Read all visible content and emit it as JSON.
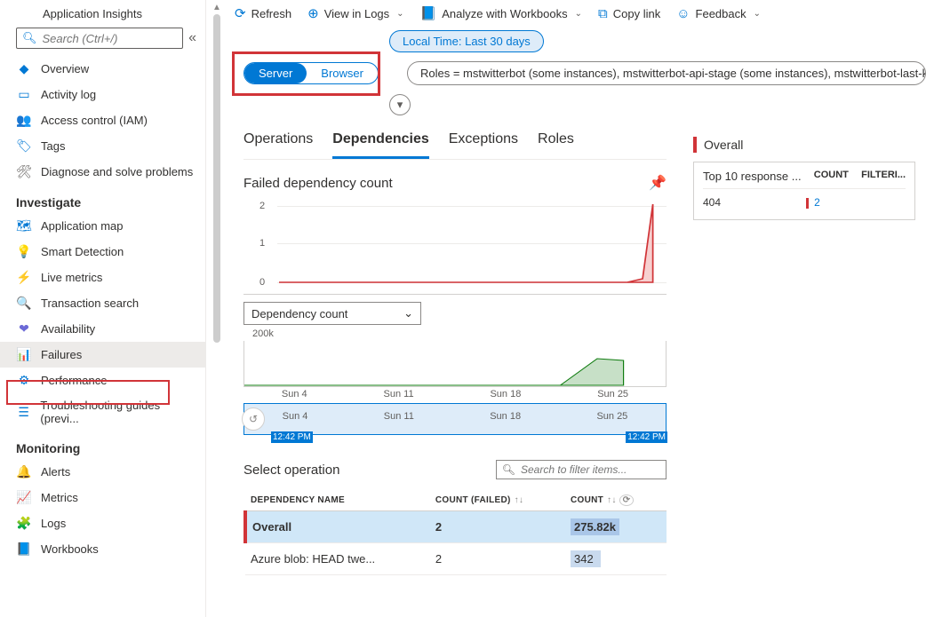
{
  "header": {
    "title": "Application Insights",
    "search_placeholder": "Search (Ctrl+/)"
  },
  "nav": {
    "items_top": [
      {
        "icon": "◆",
        "color": "#0078d4",
        "label": "Overview",
        "name": "overview"
      },
      {
        "icon": "▭",
        "color": "#0078d4",
        "label": "Activity log",
        "name": "activity-log"
      },
      {
        "icon": "👥",
        "color": "#0078d4",
        "label": "Access control (IAM)",
        "name": "access-control"
      },
      {
        "icon": "🏷",
        "color": "#0078d4",
        "label": "Tags",
        "name": "tags"
      },
      {
        "icon": "🛠",
        "color": "#605e5c",
        "label": "Diagnose and solve problems",
        "name": "diagnose"
      }
    ],
    "group_investigate": "Investigate",
    "items_investigate": [
      {
        "icon": "🗺",
        "color": "#0078d4",
        "label": "Application map",
        "name": "application-map"
      },
      {
        "icon": "💡",
        "color": "#d29200",
        "label": "Smart Detection",
        "name": "smart-detection"
      },
      {
        "icon": "⚡",
        "color": "#0078d4",
        "label": "Live metrics",
        "name": "live-metrics"
      },
      {
        "icon": "🔍",
        "color": "#0078d4",
        "label": "Transaction search",
        "name": "transaction-search"
      },
      {
        "icon": "❤",
        "color": "#6b69d6",
        "label": "Availability",
        "name": "availability"
      },
      {
        "icon": "📊",
        "color": "#d13438",
        "label": "Failures",
        "name": "failures",
        "active": true
      },
      {
        "icon": "⚙",
        "color": "#0078d4",
        "label": "Performance",
        "name": "performance"
      },
      {
        "icon": "☰",
        "color": "#0078d4",
        "label": "Troubleshooting guides (previ...",
        "name": "troubleshooting"
      }
    ],
    "group_monitoring": "Monitoring",
    "items_monitoring": [
      {
        "icon": "🔔",
        "color": "#107c10",
        "label": "Alerts",
        "name": "alerts"
      },
      {
        "icon": "📈",
        "color": "#0078d4",
        "label": "Metrics",
        "name": "metrics"
      },
      {
        "icon": "🧩",
        "color": "#881798",
        "label": "Logs",
        "name": "logs"
      },
      {
        "icon": "📘",
        "color": "#0078d4",
        "label": "Workbooks",
        "name": "workbooks"
      }
    ]
  },
  "toolbar": {
    "refresh": "Refresh",
    "view_logs": "View in Logs",
    "analyze": "Analyze with Workbooks",
    "copy_link": "Copy link",
    "feedback": "Feedback"
  },
  "filters": {
    "time_range": "Local Time: Last 30 days",
    "toggle": {
      "server": "Server",
      "browser": "Browser"
    },
    "roles": "Roles = mstwitterbot (some instances), mstwitterbot-api-stage (some instances), mstwitterbot-last-k"
  },
  "tabs": {
    "operations": "Operations",
    "dependencies": "Dependencies",
    "exceptions": "Exceptions",
    "roles": "Roles"
  },
  "chart1": {
    "title": "Failed dependency count",
    "dep_dropdown": "Dependency count",
    "label_200k": "200k"
  },
  "axis": {
    "t1": "Sun 4",
    "t2": "Sun 11",
    "t3": "Sun 18",
    "t4": "Sun 25",
    "h": "12:42 PM"
  },
  "select_op": {
    "title": "Select operation",
    "filter_placeholder": "Search to filter items..."
  },
  "op_table": {
    "col1": "DEPENDENCY NAME",
    "col2": "COUNT (FAILED)",
    "col3": "COUNT",
    "row_overall": {
      "name": "Overall",
      "failed": "2",
      "count": "275.82k"
    },
    "row1": {
      "name": "Azure blob: HEAD twe...",
      "failed": "2",
      "count": "342"
    }
  },
  "side": {
    "title": "Overall",
    "top_label": "Top 10 response ...",
    "col_count": "COUNT",
    "col_filter": "FILTERI...",
    "row": {
      "code": "404",
      "count": "2"
    }
  },
  "chart_data": {
    "type": "line",
    "title": "Failed dependency count",
    "x_categories": [
      "Sun 4",
      "Sun 11",
      "Sun 18",
      "Sun 25"
    ],
    "ylim": [
      0,
      2
    ],
    "series": [
      {
        "name": "failed",
        "values": [
          0,
          0,
          0,
          0.2,
          2
        ]
      }
    ],
    "secondary": {
      "label": "Dependency count",
      "ylabel": "200k"
    }
  }
}
